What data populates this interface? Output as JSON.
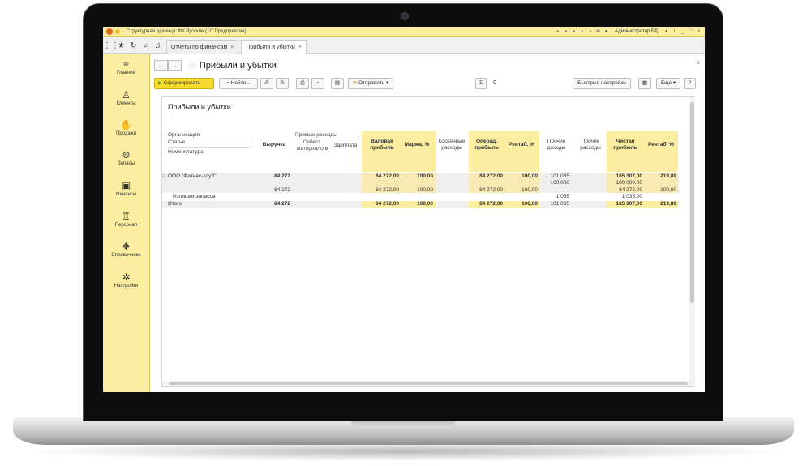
{
  "window": {
    "title": "Структурная единица: ФК Русские  (1С:Предприятие)",
    "user": "Администратор БД"
  },
  "tabs": [
    {
      "label": "Отчеты по финансам"
    },
    {
      "label": "Прибыли и убытки"
    }
  ],
  "sidebar": {
    "items": [
      {
        "label": "Главное",
        "icon": "menu-icon"
      },
      {
        "label": "Клиенты",
        "icon": "clients-icon"
      },
      {
        "label": "Продажи",
        "icon": "sales-icon"
      },
      {
        "label": "Запасы",
        "icon": "stock-icon"
      },
      {
        "label": "Финансы",
        "icon": "wallet-icon"
      },
      {
        "label": "Персонал",
        "icon": "staff-icon"
      },
      {
        "label": "Справочники",
        "icon": "catalogs-icon"
      },
      {
        "label": "Настройки",
        "icon": "settings-icon"
      }
    ]
  },
  "form": {
    "title": "Прибыли и убытки"
  },
  "toolbar": {
    "generate_label": "Сформировать",
    "find_label": "Найти...",
    "send_label": "Отправить",
    "sum_symbol": "Σ",
    "sum_value": "0",
    "quick_settings_label": "Быстрые настройки",
    "more_label": "Еще",
    "help_label": "?"
  },
  "report": {
    "title": "Прибыли и убытки",
    "row_headers": [
      "Организация",
      "Статья",
      "Номенклатура"
    ],
    "group_header": "Прямые расходы",
    "columns": {
      "revenue": "Выручка",
      "cost_materials": "Себест. материало в",
      "salary": "Зарплата",
      "gross_profit": "Валовая прибыль",
      "margin": "Маржа, %",
      "indirect": "Косвенные расходы",
      "operating_profit": "Операц. прибыль",
      "profitability": "Рентаб. %",
      "other_income": "Прочие доходы",
      "other_expenses": "Прочие расходы",
      "net_profit": "Чистая прибыль",
      "net_profitability": "Рентаб. %"
    },
    "rows": [
      {
        "name": "ООО \"Фитнес-клуб\"",
        "revenue": "84 272",
        "gross": "84 272,00",
        "margin": "100,00",
        "oper": "84 272,00",
        "rent": "100,00",
        "other_income": "101 035",
        "net": "185 307,00",
        "net_rent": "219,89"
      },
      {
        "name": "",
        "revenue": "",
        "gross": "",
        "margin": "",
        "oper": "",
        "rent": "",
        "other_income": "100 000",
        "net": "100 000,00",
        "net_rent": ""
      },
      {
        "name": "",
        "revenue": "84 272",
        "gross": "84 272,00",
        "margin": "100,00",
        "oper": "84 272,00",
        "rent": "100,00",
        "other_income": "",
        "net": "84 272,00",
        "net_rent": "100,00"
      },
      {
        "name": "Излишки запасов",
        "revenue": "",
        "gross": "",
        "margin": "",
        "oper": "",
        "rent": "",
        "other_income": "1 035",
        "net": "1 035,00",
        "net_rent": ""
      }
    ],
    "total": {
      "name": "Итого",
      "revenue": "84 272",
      "gross": "84 272,00",
      "margin": "100,00",
      "oper": "84 272,00",
      "rent": "100,00",
      "other_income": "101 035",
      "net": "185 307,00",
      "net_rent": "219,89"
    }
  }
}
